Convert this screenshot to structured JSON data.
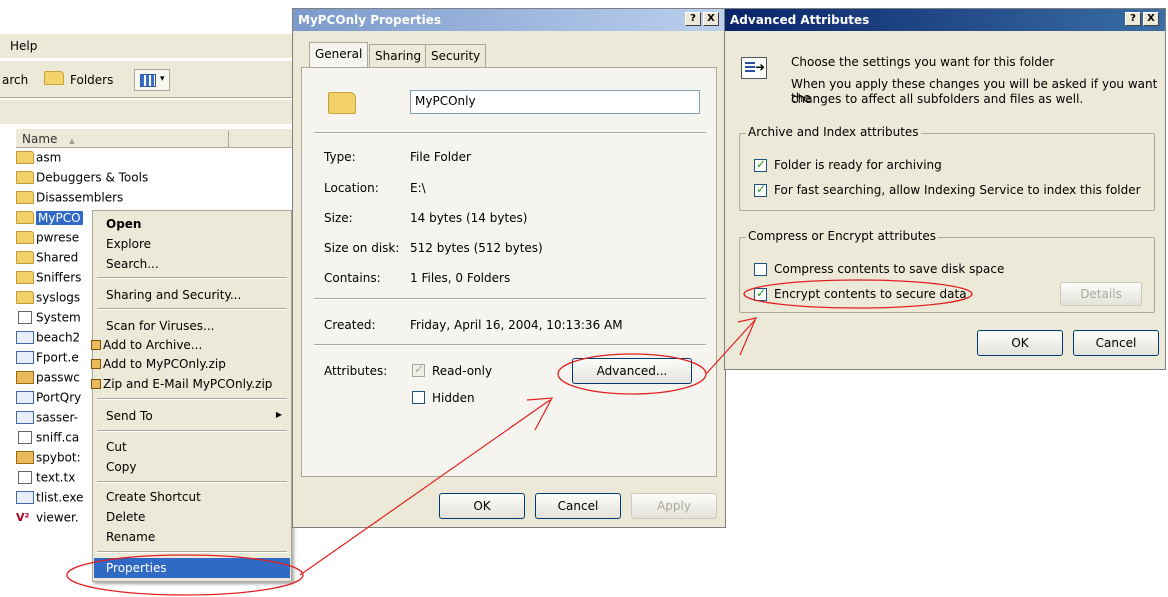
{
  "explorer": {
    "menu": "Help",
    "toolbar": {
      "search_partial": "arch",
      "folders_label": "Folders"
    },
    "list_header": "Name",
    "sort_indicator": "▲",
    "files": [
      {
        "name": "asm",
        "icon": "folder"
      },
      {
        "name": "Debuggers & Tools",
        "icon": "folder"
      },
      {
        "name": "Disassemblers",
        "icon": "folder"
      },
      {
        "name": "MyPCO",
        "icon": "folder"
      },
      {
        "name": "pwrese",
        "icon": "folder"
      },
      {
        "name": "Shared",
        "icon": "folder"
      },
      {
        "name": "Sniffers",
        "icon": "folder"
      },
      {
        "name": "syslogs",
        "icon": "folder"
      },
      {
        "name": "System",
        "icon": "file"
      },
      {
        "name": "beach2",
        "icon": "exe"
      },
      {
        "name": "Fport.e",
        "icon": "exe"
      },
      {
        "name": "passwc",
        "icon": "zip"
      },
      {
        "name": "PortQry",
        "icon": "exe"
      },
      {
        "name": "sasser-",
        "icon": "exe"
      },
      {
        "name": "sniff.ca",
        "icon": "file"
      },
      {
        "name": "spybot:",
        "icon": "zip"
      },
      {
        "name": "text.tx",
        "icon": "file"
      },
      {
        "name": "tlist.exe",
        "icon": "exe"
      },
      {
        "name": "viewer.",
        "icon": "vd"
      }
    ]
  },
  "context_menu": {
    "open": "Open",
    "explore": "Explore",
    "search": "Search...",
    "sharing": "Sharing and Security...",
    "scan": "Scan for Viruses...",
    "add_archive": "Add to Archive...",
    "add_zip": "Add to MyPCOnly.zip",
    "zip_email": "Zip and E-Mail MyPCOnly.zip",
    "send_to": "Send To",
    "send_to_arrow": "▶",
    "cut": "Cut",
    "copy": "Copy",
    "create_shortcut": "Create Shortcut",
    "delete": "Delete",
    "rename": "Rename",
    "properties": "Properties"
  },
  "properties_dialog": {
    "title": "MyPCOnly Properties",
    "help_btn": "?",
    "close_btn": "X",
    "tabs": [
      "General",
      "Sharing",
      "Security"
    ],
    "folder_name": "MyPCOnly",
    "rows": [
      {
        "label": "Type:",
        "value": "File Folder"
      },
      {
        "label": "Location:",
        "value": "E:\\"
      },
      {
        "label": "Size:",
        "value": "14 bytes (14 bytes)"
      },
      {
        "label": "Size on disk:",
        "value": "512 bytes (512 bytes)"
      },
      {
        "label": "Contains:",
        "value": "1 Files, 0 Folders"
      }
    ],
    "created_label": "Created:",
    "created_value": "Friday, April 16, 2004, 10:13:36 AM",
    "attributes_label": "Attributes:",
    "readonly_label": "Read-only",
    "readonly_checked": true,
    "hidden_label": "Hidden",
    "hidden_checked": false,
    "advanced_button": "Advanced...",
    "ok": "OK",
    "cancel": "Cancel",
    "apply": "Apply"
  },
  "advanced_dialog": {
    "title": "Advanced Attributes",
    "help_btn": "?",
    "close_btn": "X",
    "intro_line1": "Choose the settings you want for this folder",
    "intro_line2": "When you apply these changes you will be asked if you want the",
    "intro_line3": "changes to affect all subfolders and files as well.",
    "archive_group": "Archive and Index attributes",
    "archive_check": "Folder is ready for archiving",
    "archive_checked": true,
    "index_check": "For fast searching, allow Indexing Service to index this folder",
    "index_checked": true,
    "compress_group": "Compress or Encrypt attributes",
    "compress_check": "Compress contents to save disk space",
    "compress_checked": false,
    "encrypt_check": "Encrypt contents to secure data",
    "encrypt_checked": true,
    "details_button": "Details",
    "ok": "OK",
    "cancel": "Cancel"
  },
  "colors": {
    "selection": "#316ac5",
    "dialog_bg": "#ece9d8",
    "annotation": "#e02020"
  }
}
